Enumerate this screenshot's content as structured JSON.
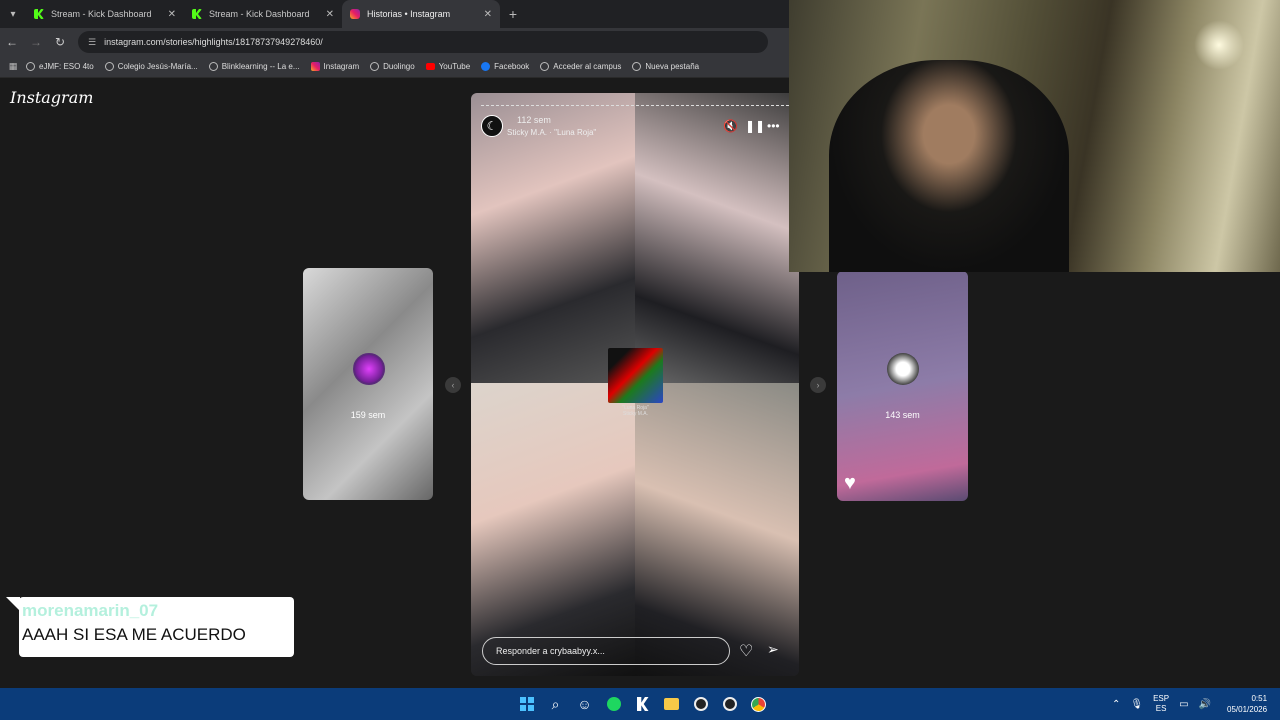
{
  "browser": {
    "tabs": [
      {
        "label": "Stream - Kick Dashboard",
        "favicon": "kick-icon"
      },
      {
        "label": "Stream - Kick Dashboard",
        "favicon": "kick-icon"
      },
      {
        "label": "Historias • Instagram",
        "favicon": "instagram-icon",
        "active": true
      }
    ],
    "url": "instagram.com/stories/highlights/18178737949278460/",
    "bookmarks": [
      "eJMF: ESO 4to",
      "Colegio Jesús-María...",
      "Blinklearning -- La e...",
      "Instagram",
      "Duolingo",
      "YouTube",
      "Facebook",
      "Acceder al campus",
      "Nueva pestaña"
    ]
  },
  "instagram": {
    "logo": "Instagram",
    "prev_story": {
      "age": "159 sem"
    },
    "next_story": {
      "age": "143 sem"
    },
    "story": {
      "age": "112 sem",
      "music": "Sticky M.A. · \"Luna Roja\"",
      "sticker_caption_1": "\"Luna Roja\"",
      "sticker_caption_2": "Sticky M.A.",
      "reply_placeholder": "Responder a crybaabyy.x..."
    }
  },
  "chat_overlay": {
    "username": "morenamarin_07",
    "message": "AAAH SI ESA ME ACUERDO",
    "username_color": "#b4f0dd"
  },
  "taskbar": {
    "lang_1": "ESP",
    "lang_2": "ES",
    "time": "0:51",
    "date": "05/01/2026"
  },
  "colors": {
    "accent": "#53fc18",
    "taskbar": "#0b3c7a"
  }
}
